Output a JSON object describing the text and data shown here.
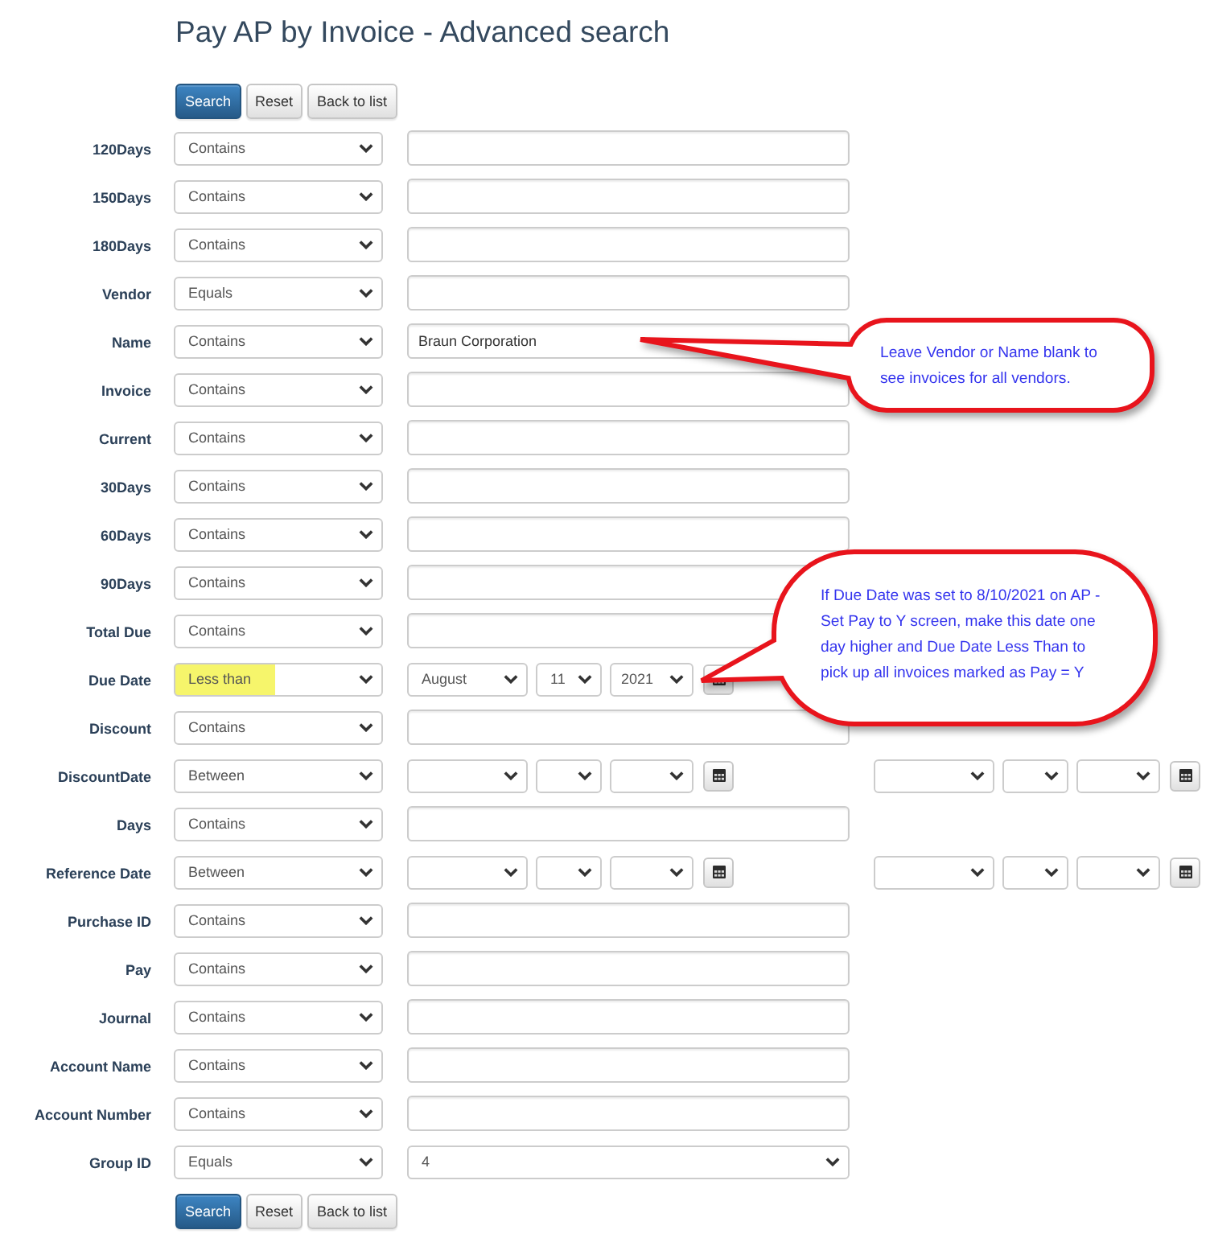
{
  "page": {
    "title": "Pay AP by Invoice - Advanced search"
  },
  "top_buttons": [
    {
      "label": "Search",
      "kind": "primary"
    },
    {
      "label": "Reset",
      "kind": "default"
    },
    {
      "label": "Back to list",
      "kind": "default"
    }
  ],
  "fields": [
    {
      "label": "120Days",
      "operator": "Contains",
      "highlighted": false,
      "kind": "text"
    },
    {
      "label": "150Days",
      "operator": "Contains",
      "highlighted": false,
      "kind": "text"
    },
    {
      "label": "180Days",
      "operator": "Contains",
      "highlighted": false,
      "kind": "text"
    },
    {
      "label": "Vendor",
      "operator": "Equals",
      "highlighted": false,
      "kind": "text"
    },
    {
      "label": "Name",
      "operator": "Contains",
      "highlighted": false,
      "kind": "text",
      "value": "Braun Corporation"
    },
    {
      "label": "Invoice",
      "operator": "Contains",
      "highlighted": false,
      "kind": "text"
    },
    {
      "label": "Current",
      "operator": "Contains",
      "highlighted": false,
      "kind": "text"
    },
    {
      "label": "30Days",
      "operator": "Contains",
      "highlighted": false,
      "kind": "text"
    },
    {
      "label": "60Days",
      "operator": "Contains",
      "highlighted": false,
      "kind": "text"
    },
    {
      "label": "90Days",
      "operator": "Contains",
      "highlighted": false,
      "kind": "text"
    },
    {
      "label": "Total Due",
      "operator": "Contains",
      "highlighted": false,
      "kind": "text"
    },
    {
      "label": "Due Date",
      "operator": "Less than",
      "highlighted": true,
      "kind": "date",
      "date": {
        "month": "August",
        "day": "11",
        "year": "2021"
      }
    },
    {
      "label": "Discount",
      "operator": "Contains",
      "highlighted": false,
      "kind": "text"
    },
    {
      "label": "DiscountDate",
      "operator": "Between",
      "highlighted": false,
      "kind": "date_range"
    },
    {
      "label": "Days",
      "operator": "Contains",
      "highlighted": false,
      "kind": "text"
    },
    {
      "label": "Reference Date",
      "operator": "Between",
      "highlighted": false,
      "kind": "date_range"
    },
    {
      "label": "Purchase ID",
      "operator": "Contains",
      "highlighted": false,
      "kind": "text"
    },
    {
      "label": "Pay",
      "operator": "Contains",
      "highlighted": false,
      "kind": "text"
    },
    {
      "label": "Journal",
      "operator": "Contains",
      "highlighted": false,
      "kind": "text"
    },
    {
      "label": "Account Name",
      "operator": "Contains",
      "highlighted": false,
      "kind": "text"
    },
    {
      "label": "Account Number",
      "operator": "Contains",
      "highlighted": false,
      "kind": "text"
    },
    {
      "label": "Group ID",
      "operator": "Equals",
      "highlighted": false,
      "kind": "select",
      "value": "4"
    }
  ],
  "bottom_buttons": [
    {
      "label": "Search",
      "kind": "primary"
    },
    {
      "label": "Reset",
      "kind": "default"
    },
    {
      "label": "Back to list",
      "kind": "default"
    }
  ],
  "callouts": [
    {
      "text": "Leave Vendor or Name blank to see invoices for all vendors."
    },
    {
      "text": "If Due Date was set to 8/10/2021 on AP - Set Pay to Y screen, make this date one day higher and Due Date Less Than to pick up all invoices marked as Pay = Y"
    }
  ]
}
